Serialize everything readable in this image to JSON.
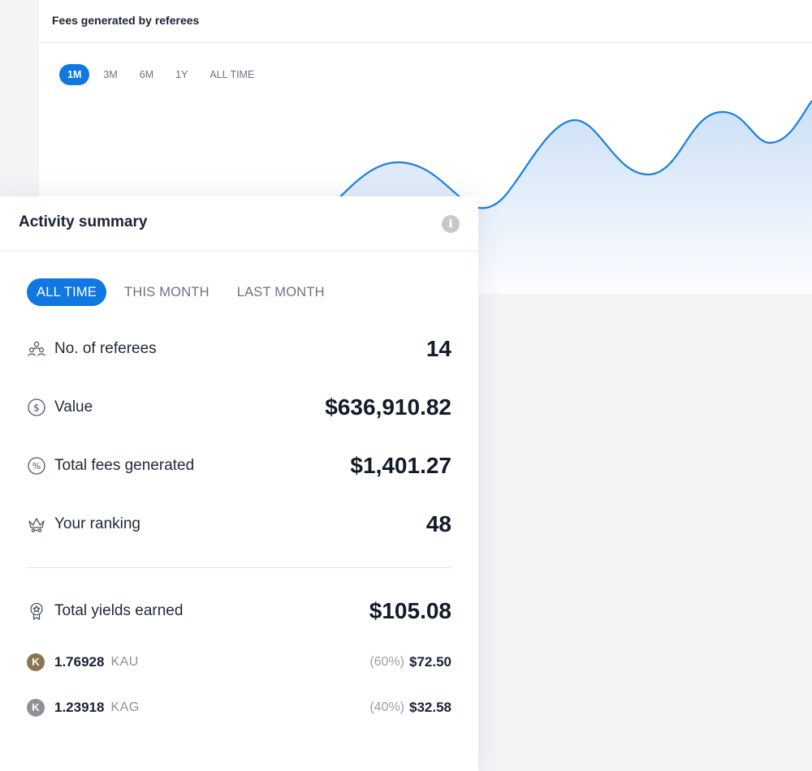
{
  "fees_card": {
    "title": "Fees generated by referees",
    "range_tabs": [
      {
        "label": "1M",
        "active": true
      },
      {
        "label": "3M",
        "active": false
      },
      {
        "label": "6M",
        "active": false
      },
      {
        "label": "1Y",
        "active": false
      },
      {
        "label": "ALL TIME",
        "active": false
      }
    ]
  },
  "summary": {
    "title": "Activity summary",
    "info_icon": "info-icon",
    "period_tabs": [
      {
        "label": "ALL TIME",
        "active": true
      },
      {
        "label": "THIS MONTH",
        "active": false
      },
      {
        "label": "LAST MONTH",
        "active": false
      }
    ],
    "stats": [
      {
        "icon": "referees-icon",
        "label": "No. of referees",
        "value": "14"
      },
      {
        "icon": "dollar-circle-icon",
        "label": "Value",
        "value": "$636,910.82"
      },
      {
        "icon": "percent-circle-icon",
        "label": "Total fees generated",
        "value": "$1,401.27"
      },
      {
        "icon": "crown-icon",
        "label": "Your ranking",
        "value": "48"
      }
    ],
    "yields": {
      "icon": "medal-icon",
      "label": "Total yields earned",
      "value": "$105.08",
      "coins": [
        {
          "icon": "kau-coin-icon",
          "amount": "1.76928",
          "symbol": "KAU",
          "pct": "(60%)",
          "usd": "$72.50"
        },
        {
          "icon": "kag-coin-icon",
          "amount": "1.23918",
          "symbol": "KAG",
          "pct": "(40%)",
          "usd": "$32.58"
        }
      ]
    }
  },
  "colors": {
    "accent": "#1078e0",
    "line": "#1a7fe0",
    "kau_coin": "#8b7553",
    "kag_coin": "#8e9196"
  }
}
